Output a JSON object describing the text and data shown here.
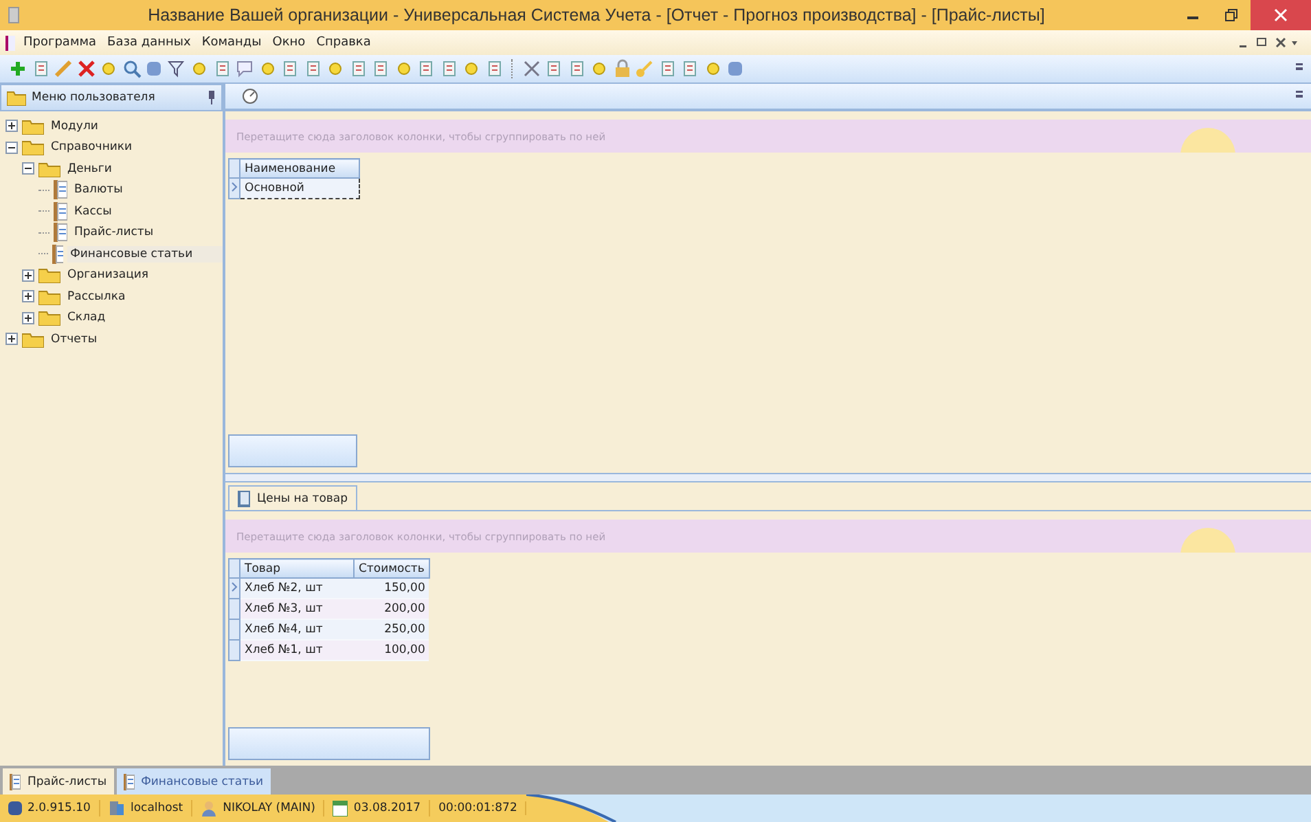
{
  "window": {
    "title": "Название Вашей организации - Универсальная Система Учета - [Отчет - Прогноз производства] - [Прайс-листы]"
  },
  "menu": [
    "Программа",
    "База данных",
    "Команды",
    "Окно",
    "Справка"
  ],
  "sidebar": {
    "title": "Меню пользователя",
    "tree": [
      {
        "label": "Модули",
        "kind": "folder",
        "expanded": false,
        "selected": false
      },
      {
        "label": "Справочники",
        "kind": "folder",
        "expanded": true,
        "selected": false,
        "children": [
          {
            "label": "Деньги",
            "kind": "folder",
            "expanded": true,
            "selected": false,
            "children": [
              {
                "label": "Валюты",
                "kind": "doc",
                "selected": false
              },
              {
                "label": "Кассы",
                "kind": "doc",
                "selected": false
              },
              {
                "label": "Прайс-листы",
                "kind": "doc",
                "selected": false
              },
              {
                "label": "Финансовые статьи",
                "kind": "doc",
                "selected": true
              }
            ]
          },
          {
            "label": "Организация",
            "kind": "folder",
            "expanded": false,
            "selected": false
          },
          {
            "label": "Рассылка",
            "kind": "folder",
            "expanded": false,
            "selected": false
          },
          {
            "label": "Склад",
            "kind": "folder",
            "expanded": false,
            "selected": false
          }
        ]
      },
      {
        "label": "Отчеты",
        "kind": "folder",
        "expanded": false,
        "selected": false
      }
    ]
  },
  "top_grid": {
    "group_hint": "Перетащите сюда заголовок колонки, чтобы сгруппировать по ней",
    "columns": [
      "Наименование"
    ],
    "rows": [
      {
        "cells": [
          "Основной"
        ],
        "selected": true
      }
    ]
  },
  "detail": {
    "tab": "Цены на товар",
    "group_hint": "Перетащите сюда заголовок колонки, чтобы сгруппировать по ней",
    "columns": [
      "Товар",
      "Стоимость"
    ],
    "rows": [
      {
        "cells": [
          "Хлеб №2, шт",
          "150,00"
        ],
        "selected": true
      },
      {
        "cells": [
          "Хлеб №3, шт",
          "200,00"
        ],
        "selected": false
      },
      {
        "cells": [
          "Хлеб №4, шт",
          "250,00"
        ],
        "selected": false
      },
      {
        "cells": [
          "Хлеб №1, шт",
          "100,00"
        ],
        "selected": false
      }
    ]
  },
  "document_tabs": [
    {
      "label": "Прайс-листы",
      "selected": true
    },
    {
      "label": "Финансовые статьи",
      "selected": false
    }
  ],
  "status_bar": {
    "version": "2.0.915.10",
    "server": "localhost",
    "user": "NIKOLAY (MAIN)",
    "date": "03.08.2017",
    "timer": "00:00:01:872"
  }
}
